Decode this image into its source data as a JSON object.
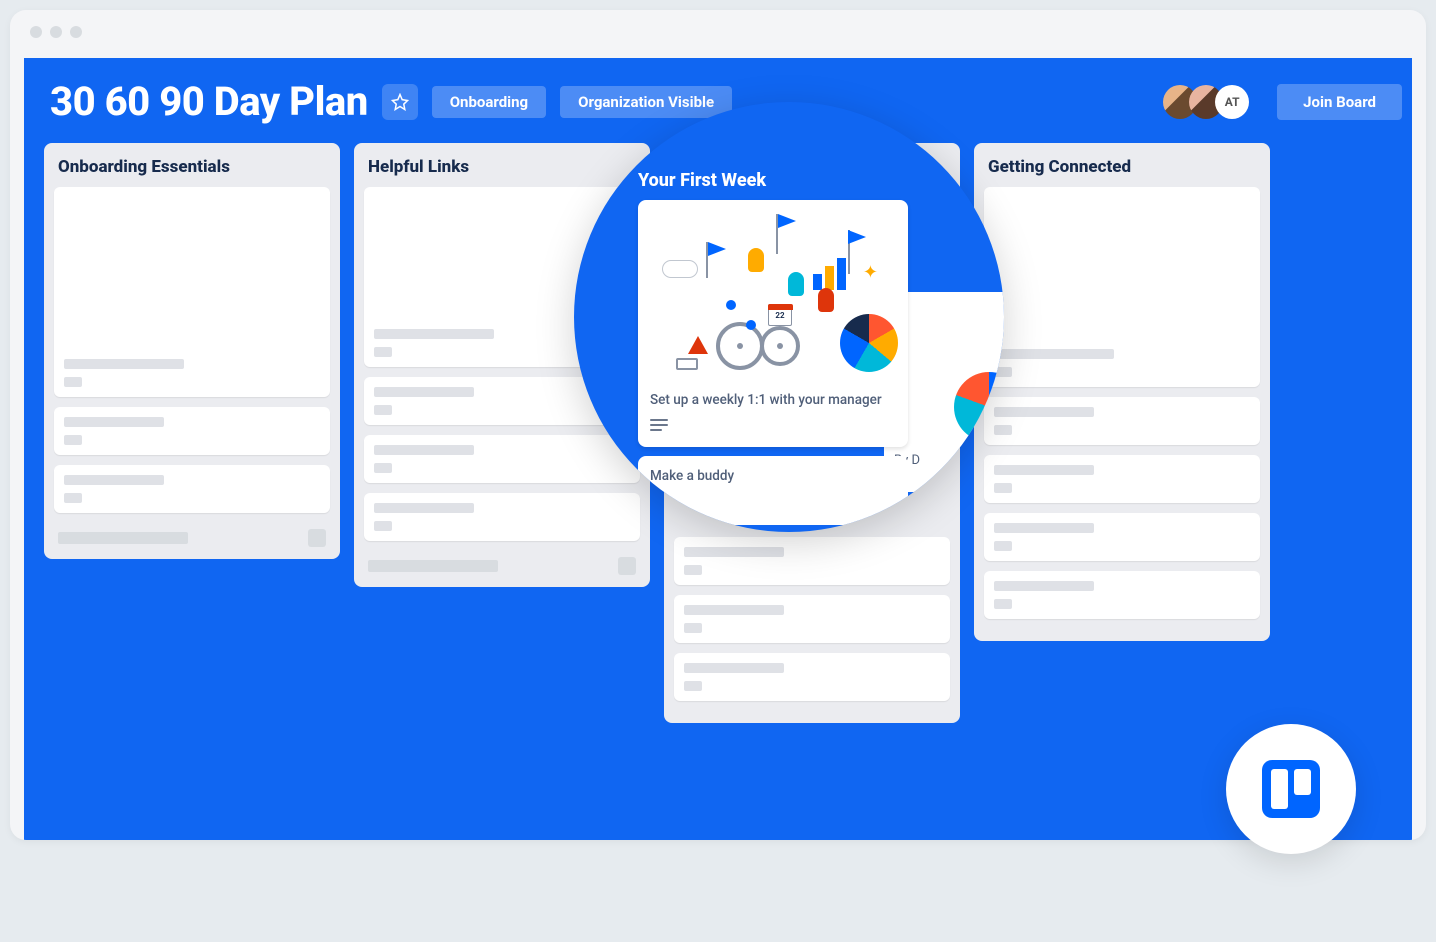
{
  "header": {
    "title": "30 60 90 Day Plan",
    "tag_onboarding": "Onboarding",
    "tag_visibility": "Organization Visible",
    "avatar_initials": "AT",
    "join_label": "Join Board"
  },
  "lists": [
    {
      "title": "Onboarding Essentials"
    },
    {
      "title": "Helpful Links"
    },
    {
      "title": "Your First Week"
    },
    {
      "title": "Getting Connected"
    }
  ],
  "spotlight": {
    "list_title": "Your First Week",
    "card1_text": "Set up a weekly 1:1 with your manager",
    "calendar_day": "22",
    "card2_text": "Make a buddy",
    "peek_text": "By D"
  },
  "colors": {
    "board": "#1066F2",
    "list_bg": "#EBECF0"
  }
}
